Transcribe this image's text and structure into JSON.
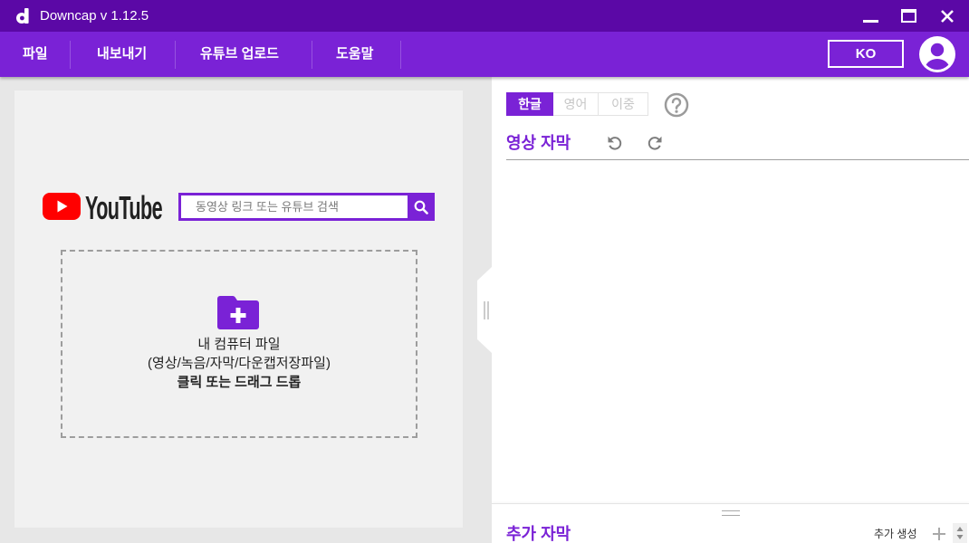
{
  "app": {
    "title": "Downcap v 1.12.5",
    "logo_icon": "downcap-logo-icon"
  },
  "window_controls": {
    "minimize_icon": "minimize-icon",
    "maximize_icon": "maximize-icon",
    "close_icon": "close-icon"
  },
  "menu": {
    "items": [
      {
        "label": "파일"
      },
      {
        "label": "내보내기"
      },
      {
        "label": "유튜브 업로드"
      },
      {
        "label": "도움말"
      }
    ],
    "language_button": "KO",
    "avatar_icon": "user-avatar-icon"
  },
  "left_panel": {
    "youtube": {
      "logo_icon": "youtube-play-icon",
      "logo_text": "YouTube",
      "search_placeholder": "동영상 링크 또는 유튜브 검색",
      "search_icon": "search-icon"
    },
    "dropzone": {
      "icon": "folder-plus-icon",
      "line1": "내 컴퓨터 파일",
      "line2": "(영상/녹음/자막/다운캡저장파일)",
      "line3": "클릭 또는 드래그 드롭"
    },
    "splitter_icon": "splitter-grip-icon"
  },
  "right_panel": {
    "language_tabs": [
      {
        "label": "한글",
        "selected": true
      },
      {
        "label": "영어",
        "selected": false
      },
      {
        "label": "이중",
        "selected": false
      }
    ],
    "help_icon": "help-circle-icon",
    "subtitle_section": {
      "title": "영상 자막",
      "undo_icon": "undo-icon",
      "redo_icon": "redo-icon"
    },
    "additional_section": {
      "title": "추가 자막",
      "add_label": "추가 생성",
      "add_icon": "plus-icon",
      "spinner_icon": "spinner-arrows-icon"
    }
  },
  "colors": {
    "title_bar": "#5b08a6",
    "menu_bar": "#7a22d6",
    "accent": "#7a22d6",
    "youtube_red": "#ff0000",
    "panel_background": "#f1f1f1"
  }
}
